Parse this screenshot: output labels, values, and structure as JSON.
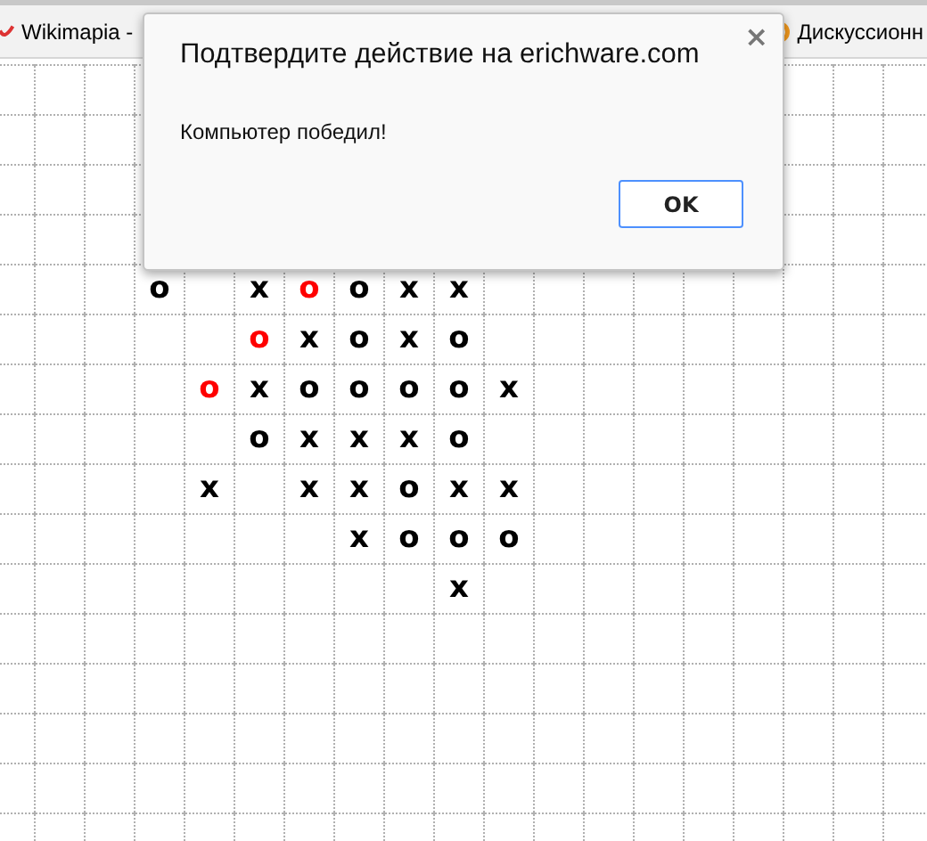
{
  "bookmarks": [
    {
      "label": "Wikimapia -",
      "kind": "wiki"
    },
    {
      "label": "Дискуссионн",
      "kind": "ring"
    }
  ],
  "board": {
    "rows": [
      [
        null,
        null,
        null,
        null,
        null,
        null,
        null,
        null,
        null,
        null,
        null
      ],
      [
        null,
        null,
        null,
        null,
        null,
        null,
        null,
        null,
        null,
        null,
        null
      ],
      [
        null,
        null,
        null,
        null,
        null,
        null,
        null,
        null,
        null,
        null,
        null
      ],
      [
        null,
        null,
        null,
        null,
        null,
        null,
        null,
        null,
        null,
        null,
        null
      ],
      [
        null,
        null,
        null,
        {
          "mark": "o",
          "highlighted": false
        },
        null,
        {
          "mark": "x",
          "highlighted": false
        },
        {
          "mark": "o",
          "highlighted": true
        },
        {
          "mark": "o",
          "highlighted": false
        },
        {
          "mark": "x",
          "highlighted": false
        },
        {
          "mark": "x",
          "highlighted": false
        },
        null
      ],
      [
        null,
        null,
        null,
        null,
        null,
        {
          "mark": "o",
          "highlighted": true
        },
        {
          "mark": "x",
          "highlighted": false
        },
        {
          "mark": "o",
          "highlighted": false
        },
        {
          "mark": "x",
          "highlighted": false
        },
        {
          "mark": "o",
          "highlighted": false
        },
        null
      ],
      [
        null,
        null,
        null,
        null,
        {
          "mark": "o",
          "highlighted": true
        },
        {
          "mark": "x",
          "highlighted": false
        },
        {
          "mark": "o",
          "highlighted": false
        },
        {
          "mark": "o",
          "highlighted": false
        },
        {
          "mark": "o",
          "highlighted": false
        },
        {
          "mark": "o",
          "highlighted": false
        },
        {
          "mark": "x",
          "highlighted": false
        }
      ],
      [
        null,
        null,
        null,
        null,
        null,
        {
          "mark": "o",
          "highlighted": false
        },
        {
          "mark": "x",
          "highlighted": false
        },
        {
          "mark": "x",
          "highlighted": false
        },
        {
          "mark": "x",
          "highlighted": false
        },
        {
          "mark": "o",
          "highlighted": false
        },
        null
      ],
      [
        null,
        null,
        null,
        null,
        {
          "mark": "x",
          "highlighted": false
        },
        null,
        {
          "mark": "x",
          "highlighted": false
        },
        {
          "mark": "x",
          "highlighted": false
        },
        {
          "mark": "o",
          "highlighted": false
        },
        {
          "mark": "x",
          "highlighted": false
        },
        {
          "mark": "x",
          "highlighted": false
        }
      ],
      [
        null,
        null,
        null,
        null,
        null,
        null,
        null,
        {
          "mark": "x",
          "highlighted": false
        },
        {
          "mark": "o",
          "highlighted": false
        },
        {
          "mark": "o",
          "highlighted": false
        },
        {
          "mark": "o",
          "highlighted": false
        }
      ],
      [
        null,
        null,
        null,
        null,
        null,
        null,
        null,
        null,
        null,
        {
          "mark": "x",
          "highlighted": false
        },
        null
      ]
    ]
  },
  "dialog": {
    "title": "Подтвердите действие на erichware.com",
    "message": "Компьютер победил!",
    "close": "×",
    "button": "OK"
  }
}
